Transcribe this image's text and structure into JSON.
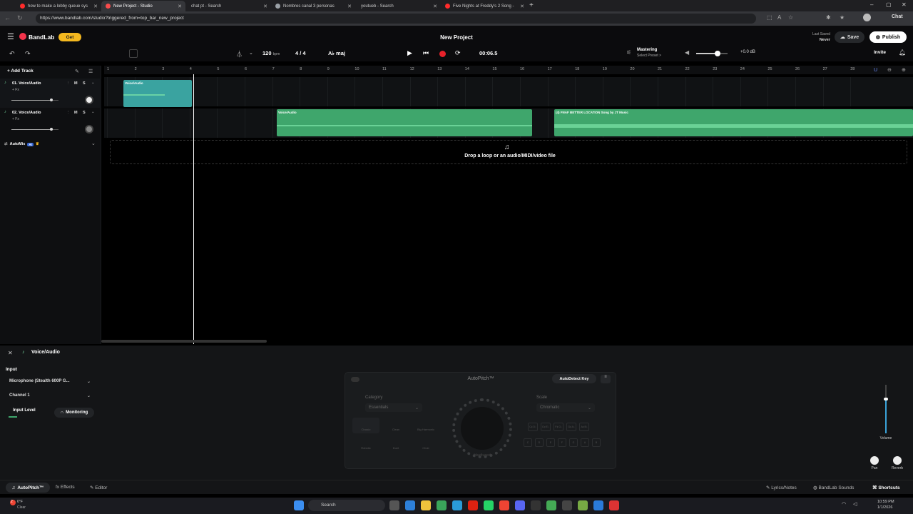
{
  "browser": {
    "tabs": [
      {
        "title": "how to make a lobby queue sys",
        "color": "#ff2b2b"
      },
      {
        "title": "New Project - Studio",
        "color": "#f64b4b",
        "active": true
      },
      {
        "title": "chat pt - Search",
        "color": "#9aa0a6"
      },
      {
        "title": "Nombres canal 3 personas",
        "color": "#9aa0a6"
      },
      {
        "title": "youtueb - Search",
        "color": "#9aa0a6"
      },
      {
        "title": "Five Nights at Freddy's 2 Song -",
        "color": "#ff2b2b"
      }
    ],
    "url": "https://www.bandlab.com/studio?triggered_from=top_bar_new_project",
    "chat_label": "Chat"
  },
  "app": {
    "logo": "BandLab",
    "get_label": "Get",
    "title": "New Project",
    "last_saved_label": "Last Saved",
    "last_saved_value": "Never",
    "save_label": "Save",
    "publish_label": "Publish",
    "invite_label": "Invite"
  },
  "toolbar": {
    "tempo": "120",
    "tempo_unit": "bpm",
    "time_sig": "4 / 4",
    "key": "A♭ maj",
    "time": "00:06.5",
    "mastering_label": "Mastering",
    "mastering_sub": "Select Preset >",
    "master_db": "+0.0 dB",
    "master_volume": 0.68
  },
  "tracks_panel": {
    "add_track": "Add Track",
    "tracks": [
      {
        "name": "01. Voice/Audio",
        "fx": "+ Fx",
        "m": "M",
        "s": "S",
        "volume": 0.85
      },
      {
        "name": "02. Voice/Audio",
        "fx": "+ Fx",
        "m": "M",
        "s": "S",
        "volume": 0.85
      }
    ],
    "automix": "AutoMix",
    "ai_badge": "AI"
  },
  "ruler": [
    "1",
    "2",
    "3",
    "4",
    "5",
    "6",
    "7",
    "8",
    "9",
    "10",
    "11",
    "12",
    "13",
    "14",
    "15",
    "16",
    "17",
    "18",
    "19",
    "20",
    "21",
    "22",
    "23",
    "24",
    "25",
    "26",
    "27",
    "28"
  ],
  "regions": [
    {
      "label": "Voice/Audio",
      "track": 0
    },
    {
      "label": "Voice/Audio",
      "track": 1
    },
    {
      "label": "(4) FNAF BETTER LOCATION Song by JT Music",
      "track": 1
    }
  ],
  "drop_text": "Drop a loop or an audio/MIDI/video file",
  "bottom_panel": {
    "track_name": "Voice/Audio",
    "input_label": "Input",
    "input_device": "Microphone (Stealth 600P G...",
    "channel": "Channel 1",
    "input_level_label": "Input Level",
    "monitoring_label": "Monitoring",
    "autopitch_title": "AutoPitch™",
    "autodetect_label": "AutoDetect Key",
    "category_label": "Category",
    "category_value": "Essentials",
    "scale_label": "Scale",
    "scale_value": "Chromatic",
    "presets": [
      "Classic",
      "Clean",
      "Big Harmonic",
      "Robotic",
      "Duet",
      "Choir"
    ],
    "notes_row1": [
      "C♯ D♭",
      "D♯ E♭",
      "F♯ G♭",
      "G♯ A♭",
      "A♯ B♭"
    ],
    "notes_row2": [
      "C",
      "D",
      "E",
      "F",
      "G",
      "A",
      "B"
    ],
    "knob_label": "Hardtuned",
    "volume_label": "Volume",
    "pan_label": "Pan",
    "reverb_label": "Reverb"
  },
  "footer": {
    "tabs": [
      "AutoPitch™",
      "Effects",
      "Editor"
    ],
    "right": [
      "Lyrics/Notes",
      "BandLab Sounds",
      "Shortcuts"
    ]
  },
  "taskbar": {
    "weather_temp": "6°F",
    "weather_text": "Clear",
    "notif": "2",
    "search": "Search",
    "time": "10:59 PM",
    "date": "1/1/2026"
  }
}
